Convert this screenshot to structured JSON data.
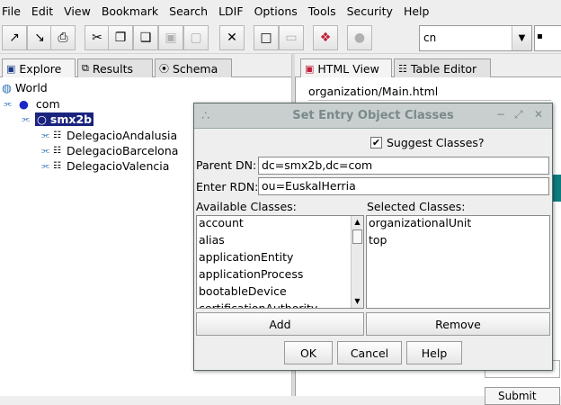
{
  "menu": [
    "File",
    "Edit",
    "View",
    "Bookmark",
    "Search",
    "LDIF",
    "Options",
    "Tools",
    "Security",
    "Help"
  ],
  "toolbar": {
    "search_combo_value": "cn",
    "second_combo_value": "▪"
  },
  "left_tabs": [
    {
      "label": "Explore",
      "icon": "tree-icon"
    },
    {
      "label": "Results",
      "icon": "binoculars-icon"
    },
    {
      "label": "Schema",
      "icon": "schema-icon"
    }
  ],
  "tree": {
    "root": "World",
    "com": "com",
    "selected": "smx2b",
    "children": [
      "DelegacioAndalusia",
      "DelegacioBarcelona",
      "DelegacioValencia"
    ]
  },
  "right_tabs": [
    {
      "label": "HTML View",
      "icon": "html-icon"
    },
    {
      "label": "Table Editor",
      "icon": "table-icon"
    }
  ],
  "html_view": {
    "path": "organization/Main.html",
    "submit_label": "Submit"
  },
  "dialog": {
    "title": "Set Entry Object Classes",
    "suggest_label": "Suggest Classes?",
    "suggest_checked": true,
    "parent_dn_label": "Parent DN:",
    "parent_dn_value": "dc=smx2b,dc=com",
    "rdn_label": "Enter RDN:",
    "rdn_value": "ou=EuskalHerria",
    "available_label": "Available Classes:",
    "available": [
      "account",
      "alias",
      "applicationEntity",
      "applicationProcess",
      "bootableDevice",
      "certificationAuthority"
    ],
    "selected_label": "Selected Classes:",
    "selected": [
      "organizationalUnit",
      "top"
    ],
    "add_label": "Add",
    "remove_label": "Remove",
    "ok_label": "OK",
    "cancel_label": "Cancel",
    "help_label": "Help"
  }
}
